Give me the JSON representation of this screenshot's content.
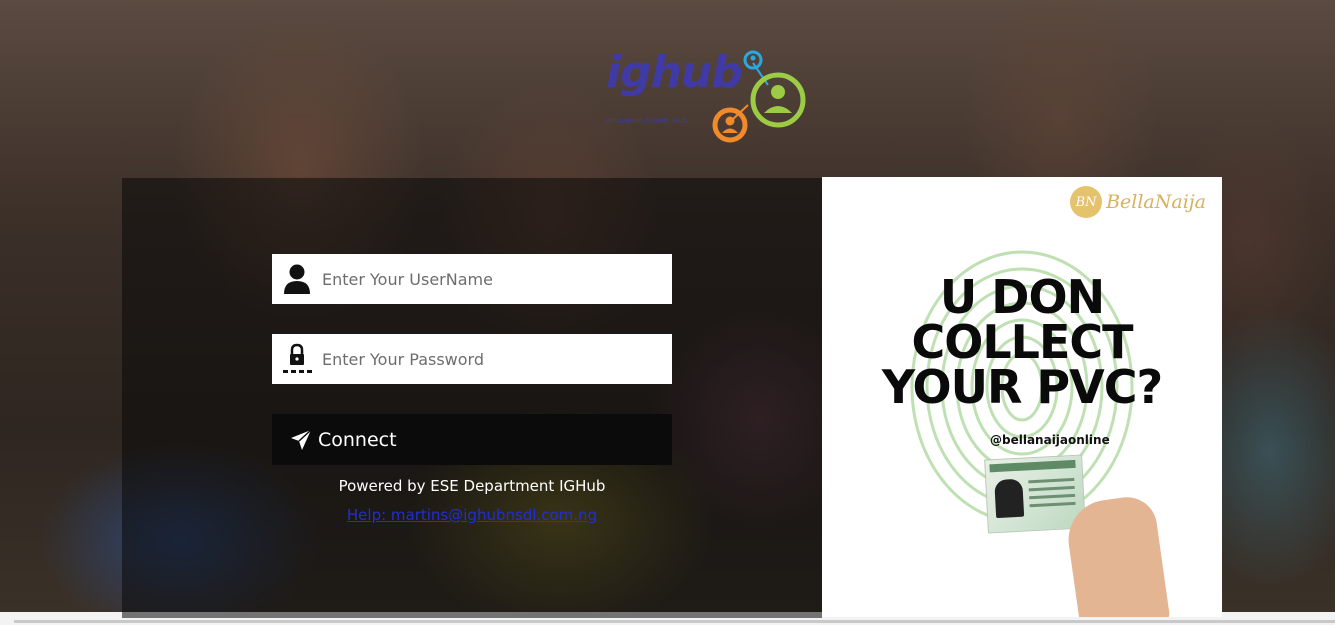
{
  "brand": {
    "logo_text": "ighub",
    "logo_subtitle": "Innovation Growth Hub",
    "colors": {
      "logo_blue": "#3f3aa6",
      "logo_green": "#9ccc43",
      "logo_orange": "#f08a2b",
      "logo_cyan": "#2ba8e0"
    }
  },
  "login": {
    "username": {
      "placeholder": "Enter Your UserName",
      "value": "",
      "icon": "user-icon"
    },
    "password": {
      "placeholder": "Enter Your Password",
      "value": "",
      "icon": "lock-icon"
    },
    "connect_button": {
      "label": "Connect",
      "icon": "send-arrow-icon"
    },
    "powered_by": "Powered by ESE Department IGHub",
    "help_link": "Help: martins@ighubnsdl.com.ng"
  },
  "advert": {
    "brand_initials": "BN",
    "brand_name": "BellaNaija",
    "headline_line1": "U DON",
    "headline_line2": "COLLECT",
    "headline_line3": "YOUR PVC?",
    "handle": "@bellanaijaonline",
    "colors": {
      "brand_gold": "#d7b25a",
      "fingerprint_green": "#bfe0b3"
    }
  }
}
